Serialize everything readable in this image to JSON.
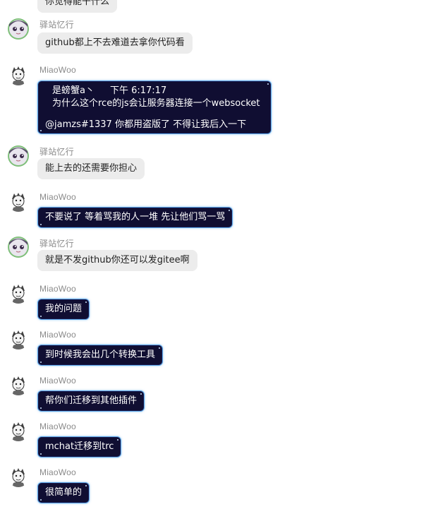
{
  "messages": [
    {
      "sender": "",
      "text": "你觉得能干什么"
    },
    {
      "sender": "驿站忆行",
      "text": "github都上不去难道去拿你代码看"
    },
    {
      "sender": "MiaoWoo",
      "quote_author": "是螃蟹a丶",
      "quote_time": "下午 6:17:17",
      "quote_text": "为什么这个rce的js会让服务器连接一个websocket",
      "text": "@jamzs#1337 你都用盗版了 不得让我后入一下"
    },
    {
      "sender": "驿站忆行",
      "text": "能上去的还需要你担心"
    },
    {
      "sender": "MiaoWoo",
      "text": "不要说了 等着骂我的人一堆 先让他们骂一骂"
    },
    {
      "sender": "驿站忆行",
      "text": "就是不发github你还可以发gitee啊"
    },
    {
      "sender": "MiaoWoo",
      "text": "我的问题"
    },
    {
      "sender": "MiaoWoo",
      "text": "到时候我会出几个转换工具"
    },
    {
      "sender": "MiaoWoo",
      "text": "帮你们迁移到其他插件"
    },
    {
      "sender": "MiaoWoo",
      "text": "mchat迁移到trc"
    },
    {
      "sender": "MiaoWoo",
      "text": "很简单的"
    }
  ],
  "colors": {
    "gray_bubble": "#ececec",
    "dark_bubble": "#100e32",
    "dark_bubble_border": "#5aa6e8",
    "name_text": "#8a8a8a"
  },
  "icons": {
    "yizhan_avatar": "anime-girl-avatar",
    "miaowoo_avatar": "sketch-character-avatar"
  }
}
